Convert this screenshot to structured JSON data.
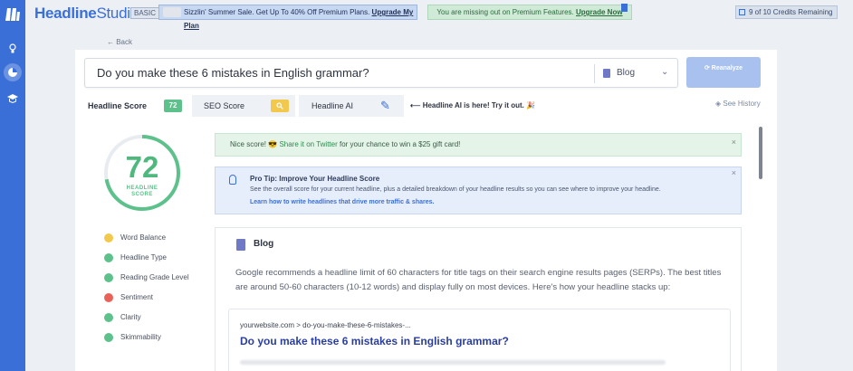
{
  "app": {
    "brand_bold": "Headline",
    "brand_light": "Studio",
    "plan_badge": "BASIC"
  },
  "promo": {
    "text": "Sizzlin' Summer Sale. Get Up To 40% Off Premium Plans.",
    "link": "Upgrade My Plan"
  },
  "premium": {
    "text": "You are missing out on Premium Features.",
    "link": "Upgrade Now"
  },
  "credits": {
    "text": "9 of 10 Credits Remaining"
  },
  "nav": {
    "back": "← Back"
  },
  "headline": {
    "value": "Do you make these 6 mistakes in English grammar?",
    "type": "Blog",
    "reanalyze_label": "Reanalyze"
  },
  "tabs": [
    {
      "label": "Headline Score",
      "badge": "72"
    },
    {
      "label": "SEO Score",
      "badge": "🔍"
    },
    {
      "label": "Headline AI"
    }
  ],
  "ai_note": "⟵ Headline AI is here! Try it out. 🎉",
  "history": "See History",
  "score": {
    "value": "72",
    "label_line1": "HEADLINE",
    "label_line2": "SCORE",
    "fraction": 0.72,
    "color": "#5cc18a"
  },
  "metrics": [
    {
      "label": "Word Balance",
      "color": "#f2c94c"
    },
    {
      "label": "Headline Type",
      "color": "#5cc18a"
    },
    {
      "label": "Reading Grade Level",
      "color": "#5cc18a"
    },
    {
      "label": "Sentiment",
      "color": "#e8625a"
    },
    {
      "label": "Clarity",
      "color": "#5cc18a"
    },
    {
      "label": "Skimmability",
      "color": "#5cc18a"
    }
  ],
  "alert": {
    "prefix": "Nice score! 😎",
    "link": "Share it on Twitter",
    "suffix": " for your chance to win a $25 gift card!"
  },
  "tip": {
    "title": "Pro Tip: Improve Your Headline Score",
    "body": "See the overall score for your current headline, plus a detailed breakdown of your headline results so you can see where to improve your headline.",
    "link": "Learn how to write headlines that drive more traffic & shares."
  },
  "blog": {
    "title": "Blog",
    "description": "Google recommends a headline limit of 60 characters for title tags on their search engine results pages (SERPs). The best titles are around 50-60 characters (10-12 words) and display fully on most devices. Here's how your headline stacks up:",
    "serp_url": "yourwebsite.com > do-you-make-these-6-mistakes-...",
    "serp_title": "Do you make these 6 mistakes in English grammar?"
  }
}
